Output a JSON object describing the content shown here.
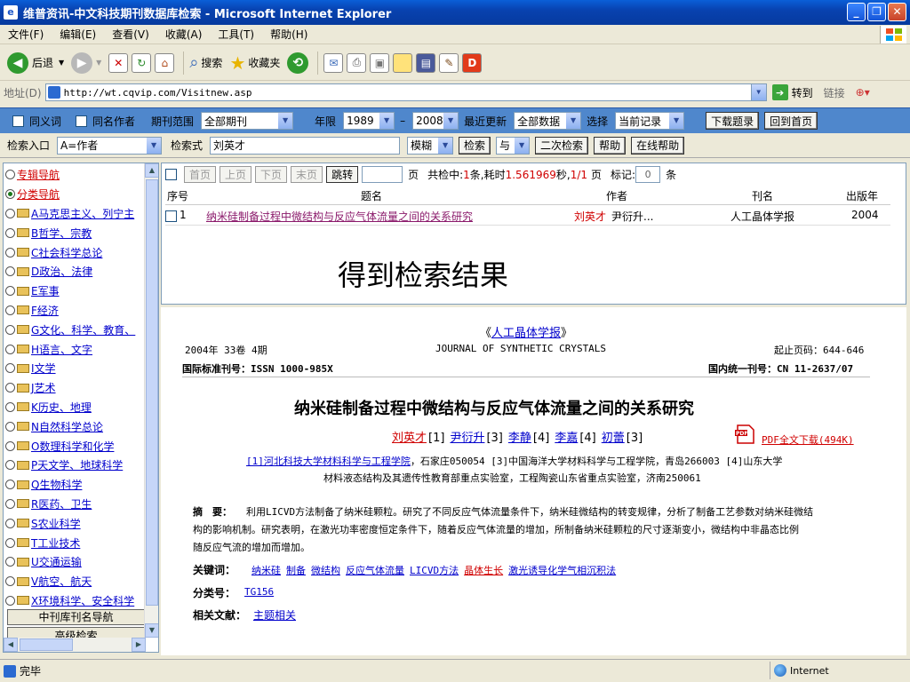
{
  "window": {
    "title": "维普资讯-中文科技期刊数据库检索 - Microsoft Internet Explorer",
    "buttons": [
      "_",
      "❐",
      "✕"
    ]
  },
  "menu": [
    "文件(F)",
    "编辑(E)",
    "查看(V)",
    "收藏(A)",
    "工具(T)",
    "帮助(H)"
  ],
  "toolbar": {
    "back": "后退",
    "search": "搜索",
    "favorites": "收藏夹"
  },
  "address": {
    "label": "地址(D)",
    "url": "http://wt.cqvip.com/Visitnew.asp",
    "go": "转到",
    "links": "链接"
  },
  "search": {
    "synonym": "同义词",
    "same_author": "同名作者",
    "journal_range_label": "期刊范围",
    "journal_range": "全部期刊",
    "year_label": "年限",
    "year_from": "1989",
    "year_dash": "–",
    "year_to": "2008",
    "update_label": "最近更新",
    "update": "全部数据",
    "select_label": "选择",
    "select": "当前记录",
    "download": "下载题录",
    "home": "回到首页",
    "entry_label": "检索入口",
    "entry": "A=作者",
    "query_label": "检索式",
    "query": "刘英才",
    "match": "模糊",
    "search_btn": "检索",
    "logic": "与",
    "second_search": "二次检索",
    "help": "帮助",
    "online_help": "在线帮助"
  },
  "nav": {
    "items": [
      {
        "label": "专辑导航",
        "style": "red",
        "radio": true,
        "on": false
      },
      {
        "label": "分类导航",
        "style": "red",
        "radio": true,
        "on": true
      },
      {
        "label": "A马克思主义、列宁主",
        "folder": true
      },
      {
        "label": "B哲学、宗教",
        "folder": true
      },
      {
        "label": "C社会科学总论",
        "folder": true
      },
      {
        "label": "D政治、法律",
        "folder": true
      },
      {
        "label": "E军事",
        "folder": true
      },
      {
        "label": "F经济",
        "folder": true
      },
      {
        "label": "G文化、科学、教育、",
        "folder": true
      },
      {
        "label": "H语言、文字",
        "folder": true
      },
      {
        "label": "I文学",
        "folder": true
      },
      {
        "label": "J艺术",
        "folder": true
      },
      {
        "label": "K历史、地理",
        "folder": true
      },
      {
        "label": "N自然科学总论",
        "folder": true
      },
      {
        "label": "O数理科学和化学",
        "folder": true
      },
      {
        "label": "P天文学、地球科学",
        "folder": true
      },
      {
        "label": "Q生物科学",
        "folder": true
      },
      {
        "label": "R医药、卫生",
        "folder": true
      },
      {
        "label": "S农业科学",
        "folder": true
      },
      {
        "label": "T工业技术",
        "folder": true
      },
      {
        "label": "U交通运输",
        "folder": true
      },
      {
        "label": "V航空、航天",
        "folder": true
      },
      {
        "label": "X环境科学、安全科学",
        "folder": true
      }
    ],
    "journal_nav": "中刊库刊名导航",
    "advanced": "高级检索"
  },
  "results": {
    "first": "首页",
    "prev": "上页",
    "next": "下页",
    "last": "末页",
    "jump": "跳转",
    "page_unit": "页",
    "summary_pre": "共检中:",
    "hits": "1",
    "summary_mid": "条,耗时",
    "time": "1.561969",
    "summary_sec": "秒,",
    "pages": "1/1",
    "summary_page": "页",
    "mark_label": "标记:",
    "mark_count": "0",
    "mark_unit": "条",
    "headers": {
      "no": "序号",
      "title": "题名",
      "author": "作者",
      "journal": "刊名",
      "year": "出版年"
    },
    "row": {
      "no": "1",
      "title": "纳米硅制备过程中微结构与反应气体流量之间的关系研究",
      "author1": "刘英才",
      "author2": "尹衍升...",
      "journal": "人工晶体学报",
      "year": "2004"
    },
    "overlay": "得到检索结果"
  },
  "detail": {
    "journal_cn": "人工晶体学报",
    "journal_brackets": [
      "《",
      "》"
    ],
    "issue": "2004年 33卷 4期",
    "journal_en": "JOURNAL OF SYNTHETIC CRYSTALS",
    "pages": "起止页码：644-646",
    "issn": "国际标准刊号：ISSN 1000-985X",
    "cn": "国内统一刊号：CN 11-2637/07",
    "title": "纳米硅制备过程中微结构与反应气体流量之间的关系研究",
    "authors": [
      {
        "name": "刘英才",
        "ref": "[1]",
        "red": true
      },
      {
        "name": "尹衍升",
        "ref": "[3]"
      },
      {
        "name": "李静",
        "ref": "[4]"
      },
      {
        "name": "李嘉",
        "ref": "[4]"
      },
      {
        "name": "初蕾",
        "ref": "[3]"
      }
    ],
    "pdf_icon": "PDF",
    "pdf": "PDF全文下载(494K)",
    "affil1_link": "[1]河北科技大学材料科学与工程学院",
    "affil1_rest": "，石家庄050054 [3]中国海洋大学材料科学与工程学院，青岛266003 [4]山东大学",
    "affil2": "材料液态结构及其遗传性教育部重点实验室，工程陶瓷山东省重点实验室，济南250061",
    "abstract_label": "摘　要：",
    "abstract_lines": [
      "利用LICVD方法制备了纳米硅颗粒。研究了不同反应气体流量条件下，纳米硅微结构的转变规律，分析了制备工艺参数对纳米硅微结",
      "构的影响机制。研究表明，在激光功率密度恒定条件下，随着反应气体流量的增加，所制备纳米硅颗粒的尺寸逐渐变小，微结构中非晶态比例",
      "随反应气流的增加而增加。"
    ],
    "keywords_label": "关键词：",
    "keywords": [
      {
        "text": "纳米硅"
      },
      {
        "text": "制备"
      },
      {
        "text": "微结构"
      },
      {
        "text": "反应气体流量"
      },
      {
        "text": "LICVD方法"
      },
      {
        "text": "晶体生长",
        "red": true
      },
      {
        "text": "激光诱导化学气相沉积法"
      }
    ],
    "class_label": "分类号：",
    "class_value": "TG156",
    "related_label": "相关文献：",
    "related_value": "主题相关"
  },
  "status": {
    "text": "完毕",
    "zone": "Internet"
  }
}
